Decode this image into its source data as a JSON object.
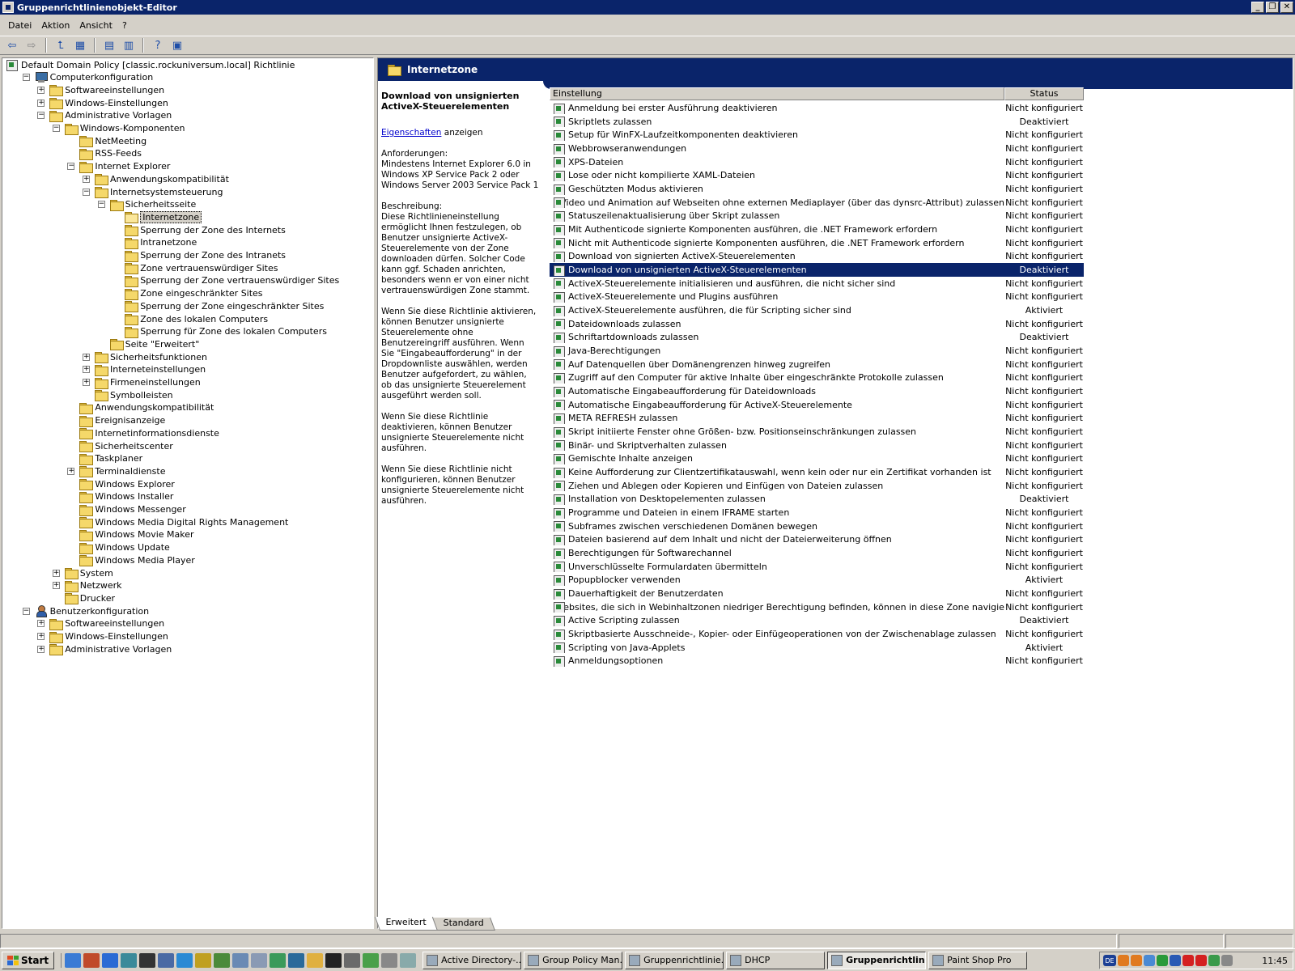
{
  "window": {
    "title": "Gruppenrichtlinienobjekt-Editor",
    "buttons": [
      "_",
      "❐",
      "✕"
    ]
  },
  "menu": [
    "Datei",
    "Aktion",
    "Ansicht",
    "?"
  ],
  "toolbar": [
    "back-icon",
    "forward-icon",
    "up-folder-icon",
    "show-hide-tree-icon",
    "properties-icon",
    "export-list-icon",
    "help-icon",
    "console-icon"
  ],
  "tree": [
    {
      "label": "Default Domain Policy [classic.rockuniversum.local] Richtlinie",
      "level": 0,
      "icon": "policy",
      "exp": ""
    },
    {
      "label": "Computerkonfiguration",
      "level": 1,
      "icon": "pc",
      "exp": "-"
    },
    {
      "label": "Softwareeinstellungen",
      "level": 2,
      "icon": "folder",
      "exp": "+"
    },
    {
      "label": "Windows-Einstellungen",
      "level": 2,
      "icon": "folder",
      "exp": "+"
    },
    {
      "label": "Administrative Vorlagen",
      "level": 2,
      "icon": "folder",
      "exp": "-"
    },
    {
      "label": "Windows-Komponenten",
      "level": 3,
      "icon": "folder",
      "exp": "-"
    },
    {
      "label": "NetMeeting",
      "level": 4,
      "icon": "folder",
      "exp": ""
    },
    {
      "label": "RSS-Feeds",
      "level": 4,
      "icon": "folder",
      "exp": ""
    },
    {
      "label": "Internet Explorer",
      "level": 4,
      "icon": "folder",
      "exp": "-"
    },
    {
      "label": "Anwendungskompatibilität",
      "level": 5,
      "icon": "folder",
      "exp": "+"
    },
    {
      "label": "Internetsystemsteuerung",
      "level": 5,
      "icon": "folder",
      "exp": "-"
    },
    {
      "label": "Sicherheitsseite",
      "level": 6,
      "icon": "folder",
      "exp": "-"
    },
    {
      "label": "Internetzone",
      "level": 7,
      "icon": "folder-open",
      "exp": "",
      "selected": true
    },
    {
      "label": "Sperrung der Zone des Internets",
      "level": 7,
      "icon": "folder",
      "exp": ""
    },
    {
      "label": "Intranetzone",
      "level": 7,
      "icon": "folder",
      "exp": ""
    },
    {
      "label": "Sperrung der Zone des Intranets",
      "level": 7,
      "icon": "folder",
      "exp": ""
    },
    {
      "label": "Zone vertrauenswürdiger Sites",
      "level": 7,
      "icon": "folder",
      "exp": ""
    },
    {
      "label": "Sperrung der Zone vertrauenswürdiger Sites",
      "level": 7,
      "icon": "folder",
      "exp": ""
    },
    {
      "label": "Zone eingeschränkter Sites",
      "level": 7,
      "icon": "folder",
      "exp": ""
    },
    {
      "label": "Sperrung der Zone eingeschränkter Sites",
      "level": 7,
      "icon": "folder",
      "exp": ""
    },
    {
      "label": "Zone des lokalen Computers",
      "level": 7,
      "icon": "folder",
      "exp": ""
    },
    {
      "label": "Sperrung für Zone des lokalen Computers",
      "level": 7,
      "icon": "folder",
      "exp": ""
    },
    {
      "label": "Seite \"Erweitert\"",
      "level": 6,
      "icon": "folder",
      "exp": ""
    },
    {
      "label": "Sicherheitsfunktionen",
      "level": 5,
      "icon": "folder",
      "exp": "+"
    },
    {
      "label": "Interneteinstellungen",
      "level": 5,
      "icon": "folder",
      "exp": "+"
    },
    {
      "label": "Firmeneinstellungen",
      "level": 5,
      "icon": "folder",
      "exp": "+"
    },
    {
      "label": "Symbolleisten",
      "level": 5,
      "icon": "folder",
      "exp": ""
    },
    {
      "label": "Anwendungskompatibilität",
      "level": 4,
      "icon": "folder",
      "exp": ""
    },
    {
      "label": "Ereignisanzeige",
      "level": 4,
      "icon": "folder",
      "exp": ""
    },
    {
      "label": "Internetinformationsdienste",
      "level": 4,
      "icon": "folder",
      "exp": ""
    },
    {
      "label": "Sicherheitscenter",
      "level": 4,
      "icon": "folder",
      "exp": ""
    },
    {
      "label": "Taskplaner",
      "level": 4,
      "icon": "folder",
      "exp": ""
    },
    {
      "label": "Terminaldienste",
      "level": 4,
      "icon": "folder",
      "exp": "+"
    },
    {
      "label": "Windows Explorer",
      "level": 4,
      "icon": "folder",
      "exp": ""
    },
    {
      "label": "Windows Installer",
      "level": 4,
      "icon": "folder",
      "exp": ""
    },
    {
      "label": "Windows Messenger",
      "level": 4,
      "icon": "folder",
      "exp": ""
    },
    {
      "label": "Windows Media Digital Rights Management",
      "level": 4,
      "icon": "folder",
      "exp": ""
    },
    {
      "label": "Windows Movie Maker",
      "level": 4,
      "icon": "folder",
      "exp": ""
    },
    {
      "label": "Windows Update",
      "level": 4,
      "icon": "folder",
      "exp": ""
    },
    {
      "label": "Windows Media Player",
      "level": 4,
      "icon": "folder",
      "exp": ""
    },
    {
      "label": "System",
      "level": 3,
      "icon": "folder",
      "exp": "+"
    },
    {
      "label": "Netzwerk",
      "level": 3,
      "icon": "folder",
      "exp": "+"
    },
    {
      "label": "Drucker",
      "level": 3,
      "icon": "folder",
      "exp": ""
    },
    {
      "label": "Benutzerkonfiguration",
      "level": 1,
      "icon": "user",
      "exp": "-"
    },
    {
      "label": "Softwareeinstellungen",
      "level": 2,
      "icon": "folder",
      "exp": "+"
    },
    {
      "label": "Windows-Einstellungen",
      "level": 2,
      "icon": "folder",
      "exp": "+"
    },
    {
      "label": "Administrative Vorlagen",
      "level": 2,
      "icon": "folder",
      "exp": "+"
    }
  ],
  "right": {
    "header": "Internetzone",
    "description": {
      "title": "Download von unsignierten ActiveX-Steuerelementen",
      "link": "Eigenschaften",
      "link_suffix": " anzeigen",
      "requirements": "Anforderungen:\nMindestens Internet Explorer 6.0 in Windows XP Service Pack 2 oder Windows Server 2003 Service Pack 1",
      "description": "Beschreibung:\nDiese Richtlinieneinstellung ermöglicht Ihnen festzulegen, ob Benutzer unsignierte ActiveX-Steuerelemente von der Zone downloaden dürfen. Solcher Code kann ggf. Schaden anrichten, besonders wenn er von einer nicht vertrauenswürdigen Zone stammt.",
      "enabled": "Wenn Sie diese Richtlinie aktivieren, können Benutzer unsignierte Steuerelemente ohne Benutzereingriff ausführen. Wenn\nSie \"Eingabeaufforderung\" in der Dropdownliste auswählen, werden Benutzer aufgefordert, zu wählen, ob das unsignierte Steuerelement ausgeführt werden soll.",
      "disabled": "Wenn Sie diese Richtlinie deaktivieren, können Benutzer unsignierte Steuerelemente nicht ausführen.",
      "notconfigured": "Wenn Sie diese Richtlinie nicht konfigurieren, können Benutzer unsignierte Steuerelemente nicht ausführen."
    },
    "columns": {
      "name": "Einstellung",
      "status": "Status"
    },
    "selected_index": 12,
    "rows": [
      {
        "name": "Anmeldung bei erster Ausführung deaktivieren",
        "status": "Nicht konfiguriert"
      },
      {
        "name": "Skriptlets zulassen",
        "status": "Deaktiviert"
      },
      {
        "name": "Setup für WinFX-Laufzeitkomponenten deaktivieren",
        "status": "Nicht konfiguriert"
      },
      {
        "name": "Webbrowseranwendungen",
        "status": "Nicht konfiguriert"
      },
      {
        "name": "XPS-Dateien",
        "status": "Nicht konfiguriert"
      },
      {
        "name": "Lose oder nicht kompilierte XAML-Dateien",
        "status": "Nicht konfiguriert"
      },
      {
        "name": "Geschützten Modus aktivieren",
        "status": "Nicht konfiguriert"
      },
      {
        "name": "Video und Animation auf Webseiten ohne externen Mediaplayer (über das dynsrc-Attribut) zulassen",
        "status": "Nicht konfiguriert"
      },
      {
        "name": "Statuszeilenaktualisierung über Skript zulassen",
        "status": "Nicht konfiguriert"
      },
      {
        "name": "Mit Authenticode signierte Komponenten ausführen, die .NET Framework erfordern",
        "status": "Nicht konfiguriert"
      },
      {
        "name": "Nicht mit Authenticode signierte Komponenten ausführen, die .NET Framework erfordern",
        "status": "Nicht konfiguriert"
      },
      {
        "name": "Download von signierten ActiveX-Steuerelementen",
        "status": "Nicht konfiguriert"
      },
      {
        "name": "Download von unsignierten ActiveX-Steuerelementen",
        "status": "Deaktiviert"
      },
      {
        "name": "ActiveX-Steuerelemente initialisieren und ausführen, die nicht sicher sind",
        "status": "Nicht konfiguriert"
      },
      {
        "name": "ActiveX-Steuerelemente und Plugins ausführen",
        "status": "Nicht konfiguriert"
      },
      {
        "name": "ActiveX-Steuerelemente ausführen, die für Scripting sicher sind",
        "status": "Aktiviert"
      },
      {
        "name": "Dateidownloads zulassen",
        "status": "Nicht konfiguriert"
      },
      {
        "name": "Schriftartdownloads zulassen",
        "status": "Deaktiviert"
      },
      {
        "name": "Java-Berechtigungen",
        "status": "Nicht konfiguriert"
      },
      {
        "name": "Auf Datenquellen über Domänengrenzen hinweg zugreifen",
        "status": "Nicht konfiguriert"
      },
      {
        "name": "Zugriff auf den Computer für aktive Inhalte über eingeschränkte Protokolle zulassen",
        "status": "Nicht konfiguriert"
      },
      {
        "name": "Automatische Eingabeaufforderung für Dateidownloads",
        "status": "Nicht konfiguriert"
      },
      {
        "name": "Automatische Eingabeaufforderung für ActiveX-Steuerelemente",
        "status": "Nicht konfiguriert"
      },
      {
        "name": "META REFRESH zulassen",
        "status": "Nicht konfiguriert"
      },
      {
        "name": "Skript initiierte Fenster ohne Größen- bzw. Positionseinschränkungen zulassen",
        "status": "Nicht konfiguriert"
      },
      {
        "name": "Binär- und Skriptverhalten zulassen",
        "status": "Nicht konfiguriert"
      },
      {
        "name": "Gemischte Inhalte anzeigen",
        "status": "Nicht konfiguriert"
      },
      {
        "name": "Keine Aufforderung zur Clientzertifikatauswahl, wenn kein oder nur ein Zertifikat vorhanden ist",
        "status": "Nicht konfiguriert"
      },
      {
        "name": "Ziehen und Ablegen oder Kopieren und Einfügen von Dateien zulassen",
        "status": "Nicht konfiguriert"
      },
      {
        "name": "Installation von Desktopelementen zulassen",
        "status": "Deaktiviert"
      },
      {
        "name": "Programme und Dateien in einem IFRAME starten",
        "status": "Nicht konfiguriert"
      },
      {
        "name": "Subframes zwischen verschiedenen Domänen bewegen",
        "status": "Nicht konfiguriert"
      },
      {
        "name": "Dateien basierend auf dem Inhalt und nicht der Dateierweiterung öffnen",
        "status": "Nicht konfiguriert"
      },
      {
        "name": "Berechtigungen für Softwarechannel",
        "status": "Nicht konfiguriert"
      },
      {
        "name": "Unverschlüsselte Formulardaten übermitteln",
        "status": "Nicht konfiguriert"
      },
      {
        "name": "Popupblocker verwenden",
        "status": "Aktiviert"
      },
      {
        "name": "Dauerhaftigkeit der Benutzerdaten",
        "status": "Nicht konfiguriert"
      },
      {
        "name": "Websites, die sich in Webinhaltzonen niedriger Berechtigung befinden, können in diese Zone navigieren",
        "status": "Nicht konfiguriert"
      },
      {
        "name": "Active Scripting zulassen",
        "status": "Deaktiviert"
      },
      {
        "name": "Skriptbasierte Ausschneide-, Kopier- oder Einfügeoperationen von der Zwischenablage zulassen",
        "status": "Nicht konfiguriert"
      },
      {
        "name": "Scripting von Java-Applets",
        "status": "Aktiviert"
      },
      {
        "name": "Anmeldungsoptionen",
        "status": "Nicht konfiguriert"
      }
    ]
  },
  "tabs": [
    {
      "label": "Erweitert",
      "active": true
    },
    {
      "label": "Standard",
      "active": false
    }
  ],
  "taskbar": {
    "start": "Start",
    "quicklaunch": [
      "ie-icon",
      "tool-icon",
      "network-icon",
      "user-icon",
      "cmd-icon",
      "monitor-icon",
      "ie2-icon",
      "wrench-icon",
      "dev-icon",
      "disk-icon",
      "box-icon",
      "tree-icon",
      "server-icon",
      "folder-icon",
      "cmd2-icon",
      "tools-icon",
      "green-icon",
      "print-icon",
      "check-icon"
    ],
    "tasks": [
      {
        "label": "Active Directory-...",
        "active": false
      },
      {
        "label": "Group Policy Man...",
        "active": false
      },
      {
        "label": "Gruppenrichtlinie...",
        "active": false
      },
      {
        "label": "DHCP",
        "active": false
      },
      {
        "label": "Gruppenrichtlin...",
        "active": true
      },
      {
        "label": "Paint Shop Pro",
        "active": false
      }
    ],
    "tray_lang": "DE",
    "clock": "11:45"
  },
  "colors": {
    "titlebar": "#0a246a",
    "selection": "#0a246a",
    "face": "#d4d0c8"
  }
}
